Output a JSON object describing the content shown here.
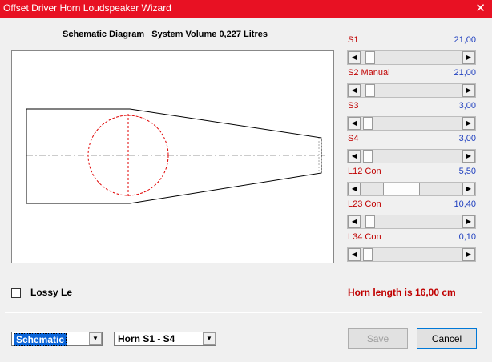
{
  "window": {
    "title": "Offset Driver Horn Loudspeaker Wizard",
    "close_glyph": "✕"
  },
  "header": {
    "diagram_label": "Schematic Diagram",
    "volume_text": "System Volume 0,227 Litres"
  },
  "params": [
    {
      "label": "S1",
      "value": "21,00",
      "position": 0.05
    },
    {
      "label": "S2  Manual",
      "value": "21,00",
      "position": 0.05
    },
    {
      "label": "S3",
      "value": "3,00",
      "position": 0.02
    },
    {
      "label": "S4",
      "value": "3,00",
      "position": 0.02
    },
    {
      "label": "L12  Con",
      "value": "5,50",
      "position": 0.22
    },
    {
      "label": "L23  Con",
      "value": "10,40",
      "position": 0.05
    },
    {
      "label": "L34  Con",
      "value": "0,10",
      "position": 0.02
    }
  ],
  "lossy": {
    "label": "Lossy Le",
    "checked": false
  },
  "horn_length": "Horn length is 16,00 cm",
  "view_select": {
    "value": "Schematic"
  },
  "horn_select": {
    "value": "Horn S1 - S4"
  },
  "buttons": {
    "save": "Save",
    "cancel": "Cancel"
  },
  "colors": {
    "titlebar": "#e81123",
    "label_red": "#c00000",
    "value_blue": "#1f3fbf",
    "driver_circle": "#e00000"
  }
}
